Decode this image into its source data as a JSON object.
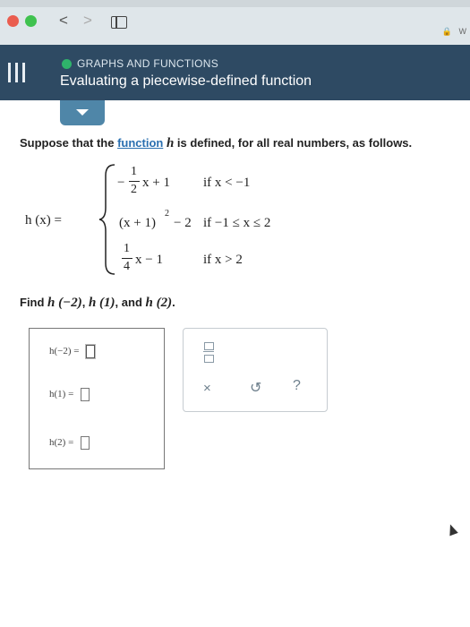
{
  "browser": {
    "back_glyph": "<",
    "forward_glyph": ">",
    "right_edge_text": "W"
  },
  "header": {
    "topic": "GRAPHS AND FUNCTIONS",
    "title": "Evaluating a piecewise-defined function",
    "topic_dot_color": "#2fb36b",
    "background": "#2e4a63"
  },
  "problem": {
    "prefix": "Suppose that the ",
    "link": "function",
    "var": "h",
    "suffix": " is defined, for all real numbers, as follows."
  },
  "definition": {
    "lhs": "h (x) =",
    "cases": [
      {
        "sign": "−",
        "num": "1",
        "den": "2",
        "tail": "x + 1",
        "condition": "if x < −1"
      },
      {
        "expr": "(x + 1)",
        "power": "2",
        "tail": "− 2",
        "condition": "if −1 ≤ x ≤ 2"
      },
      {
        "num": "1",
        "den": "4",
        "tail": "x − 1",
        "condition": "if x > 2"
      }
    ]
  },
  "find": {
    "prefix": "Find ",
    "items": [
      "h (−2)",
      "h (1)",
      "h (2)"
    ],
    "separator1": ", ",
    "separator2": ", and ",
    "suffix": "."
  },
  "answers": [
    {
      "label": "h(−2) =",
      "value": ""
    },
    {
      "label": "h(1) =",
      "value": ""
    },
    {
      "label": "h(2) =",
      "value": ""
    }
  ],
  "toolbox": {
    "clear": "×",
    "undo": "↺",
    "help": "?"
  }
}
